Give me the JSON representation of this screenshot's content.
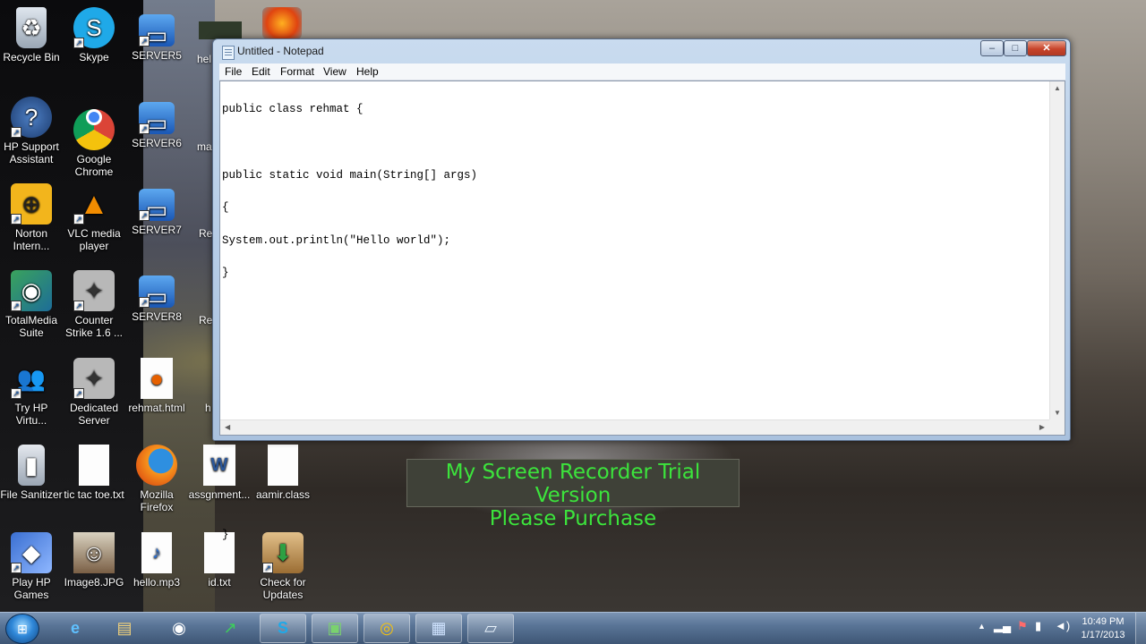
{
  "desktop": {
    "icons": [
      {
        "label": "Recycle Bin",
        "icon": "recycle-bin-icon"
      },
      {
        "label": "Skype",
        "icon": "skype-icon"
      },
      {
        "label": "SERVER5",
        "icon": "computer-icon"
      },
      {
        "label": "HP Support Assistant",
        "icon": "hp-support-icon"
      },
      {
        "label": "Google Chrome",
        "icon": "chrome-icon"
      },
      {
        "label": "SERVER6",
        "icon": "computer-icon"
      },
      {
        "label": "Norton Intern...",
        "icon": "norton-icon"
      },
      {
        "label": "VLC media player",
        "icon": "vlc-icon"
      },
      {
        "label": "SERVER7",
        "icon": "computer-icon"
      },
      {
        "label": "TotalMedia Suite",
        "icon": "totalmedia-icon"
      },
      {
        "label": "Counter Strike 1.6 ...",
        "icon": "counter-strike-icon"
      },
      {
        "label": "SERVER8",
        "icon": "computer-icon"
      },
      {
        "label": "Try HP Virtu...",
        "icon": "hp-virtual-icon"
      },
      {
        "label": "Dedicated Server",
        "icon": "counter-strike-icon"
      },
      {
        "label": "rehmat.html",
        "icon": "firefox-document-icon"
      },
      {
        "label": "File Sanitizer",
        "icon": "file-sanitizer-icon"
      },
      {
        "label": "tic tac toe.txt",
        "icon": "text-file-icon"
      },
      {
        "label": "Mozilla Firefox",
        "icon": "firefox-icon"
      },
      {
        "label": "assgnment...",
        "icon": "word-document-icon"
      },
      {
        "label": "aamir.class",
        "icon": "blank-file-icon"
      },
      {
        "label": "Play HP Games",
        "icon": "hp-games-icon"
      },
      {
        "label": "Image8.JPG",
        "icon": "photo-icon"
      },
      {
        "label": "hello.mp3",
        "icon": "mp3-file-icon"
      },
      {
        "label": "id.txt",
        "icon": "text-file-icon"
      },
      {
        "label": "Check for Updates",
        "icon": "updates-icon"
      }
    ],
    "partial_labels": [
      "hel",
      "ma",
      "Re",
      "Re",
      "h"
    ]
  },
  "notepad": {
    "title": "Untitled - Notepad",
    "menu": [
      "File",
      "Edit",
      "Format",
      "View",
      "Help"
    ],
    "code_lines": [
      "public class rehmat {",
      "",
      "public static void main(String[] args)",
      "{",
      "System.out.println(\"Hello world\");",
      "}",
      "",
      "",
      "",
      "",
      "",
      "",
      "",
      "}"
    ],
    "caption_buttons": {
      "minimize": "–",
      "maximize": "□",
      "close": "✕"
    }
  },
  "watermark": {
    "line1": "My Screen Recorder Trial Version",
    "line2": "Please Purchase"
  },
  "taskbar": {
    "start_icon": "windows-start-icon",
    "apps": [
      "internet-explorer-icon",
      "file-explorer-icon",
      "wifi-app-icon",
      "stock-chart-icon",
      "skype-icon",
      "presentation-icon",
      "chrome-icon",
      "control-panel-icon",
      "notepad-icon"
    ],
    "clock_time": "10:49 PM",
    "clock_date": "1/17/2013"
  }
}
